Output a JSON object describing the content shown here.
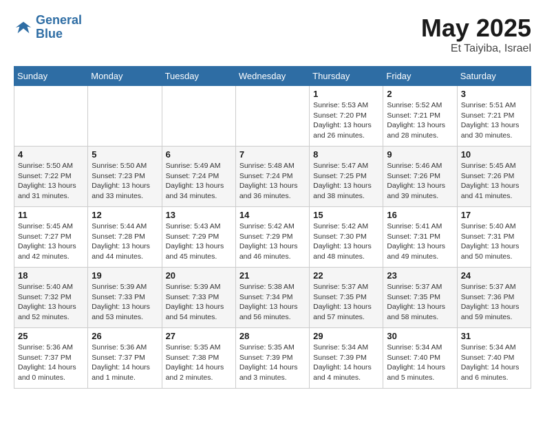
{
  "header": {
    "logo_line1": "General",
    "logo_line2": "Blue",
    "month_title": "May 2025",
    "location": "Et Taiyiba, Israel"
  },
  "days_of_week": [
    "Sunday",
    "Monday",
    "Tuesday",
    "Wednesday",
    "Thursday",
    "Friday",
    "Saturday"
  ],
  "weeks": [
    [
      {
        "day": "",
        "info": ""
      },
      {
        "day": "",
        "info": ""
      },
      {
        "day": "",
        "info": ""
      },
      {
        "day": "",
        "info": ""
      },
      {
        "day": "1",
        "info": "Sunrise: 5:53 AM\nSunset: 7:20 PM\nDaylight: 13 hours\nand 26 minutes."
      },
      {
        "day": "2",
        "info": "Sunrise: 5:52 AM\nSunset: 7:21 PM\nDaylight: 13 hours\nand 28 minutes."
      },
      {
        "day": "3",
        "info": "Sunrise: 5:51 AM\nSunset: 7:21 PM\nDaylight: 13 hours\nand 30 minutes."
      }
    ],
    [
      {
        "day": "4",
        "info": "Sunrise: 5:50 AM\nSunset: 7:22 PM\nDaylight: 13 hours\nand 31 minutes."
      },
      {
        "day": "5",
        "info": "Sunrise: 5:50 AM\nSunset: 7:23 PM\nDaylight: 13 hours\nand 33 minutes."
      },
      {
        "day": "6",
        "info": "Sunrise: 5:49 AM\nSunset: 7:24 PM\nDaylight: 13 hours\nand 34 minutes."
      },
      {
        "day": "7",
        "info": "Sunrise: 5:48 AM\nSunset: 7:24 PM\nDaylight: 13 hours\nand 36 minutes."
      },
      {
        "day": "8",
        "info": "Sunrise: 5:47 AM\nSunset: 7:25 PM\nDaylight: 13 hours\nand 38 minutes."
      },
      {
        "day": "9",
        "info": "Sunrise: 5:46 AM\nSunset: 7:26 PM\nDaylight: 13 hours\nand 39 minutes."
      },
      {
        "day": "10",
        "info": "Sunrise: 5:45 AM\nSunset: 7:26 PM\nDaylight: 13 hours\nand 41 minutes."
      }
    ],
    [
      {
        "day": "11",
        "info": "Sunrise: 5:45 AM\nSunset: 7:27 PM\nDaylight: 13 hours\nand 42 minutes."
      },
      {
        "day": "12",
        "info": "Sunrise: 5:44 AM\nSunset: 7:28 PM\nDaylight: 13 hours\nand 44 minutes."
      },
      {
        "day": "13",
        "info": "Sunrise: 5:43 AM\nSunset: 7:29 PM\nDaylight: 13 hours\nand 45 minutes."
      },
      {
        "day": "14",
        "info": "Sunrise: 5:42 AM\nSunset: 7:29 PM\nDaylight: 13 hours\nand 46 minutes."
      },
      {
        "day": "15",
        "info": "Sunrise: 5:42 AM\nSunset: 7:30 PM\nDaylight: 13 hours\nand 48 minutes."
      },
      {
        "day": "16",
        "info": "Sunrise: 5:41 AM\nSunset: 7:31 PM\nDaylight: 13 hours\nand 49 minutes."
      },
      {
        "day": "17",
        "info": "Sunrise: 5:40 AM\nSunset: 7:31 PM\nDaylight: 13 hours\nand 50 minutes."
      }
    ],
    [
      {
        "day": "18",
        "info": "Sunrise: 5:40 AM\nSunset: 7:32 PM\nDaylight: 13 hours\nand 52 minutes."
      },
      {
        "day": "19",
        "info": "Sunrise: 5:39 AM\nSunset: 7:33 PM\nDaylight: 13 hours\nand 53 minutes."
      },
      {
        "day": "20",
        "info": "Sunrise: 5:39 AM\nSunset: 7:33 PM\nDaylight: 13 hours\nand 54 minutes."
      },
      {
        "day": "21",
        "info": "Sunrise: 5:38 AM\nSunset: 7:34 PM\nDaylight: 13 hours\nand 56 minutes."
      },
      {
        "day": "22",
        "info": "Sunrise: 5:37 AM\nSunset: 7:35 PM\nDaylight: 13 hours\nand 57 minutes."
      },
      {
        "day": "23",
        "info": "Sunrise: 5:37 AM\nSunset: 7:35 PM\nDaylight: 13 hours\nand 58 minutes."
      },
      {
        "day": "24",
        "info": "Sunrise: 5:37 AM\nSunset: 7:36 PM\nDaylight: 13 hours\nand 59 minutes."
      }
    ],
    [
      {
        "day": "25",
        "info": "Sunrise: 5:36 AM\nSunset: 7:37 PM\nDaylight: 14 hours\nand 0 minutes."
      },
      {
        "day": "26",
        "info": "Sunrise: 5:36 AM\nSunset: 7:37 PM\nDaylight: 14 hours\nand 1 minute."
      },
      {
        "day": "27",
        "info": "Sunrise: 5:35 AM\nSunset: 7:38 PM\nDaylight: 14 hours\nand 2 minutes."
      },
      {
        "day": "28",
        "info": "Sunrise: 5:35 AM\nSunset: 7:39 PM\nDaylight: 14 hours\nand 3 minutes."
      },
      {
        "day": "29",
        "info": "Sunrise: 5:34 AM\nSunset: 7:39 PM\nDaylight: 14 hours\nand 4 minutes."
      },
      {
        "day": "30",
        "info": "Sunrise: 5:34 AM\nSunset: 7:40 PM\nDaylight: 14 hours\nand 5 minutes."
      },
      {
        "day": "31",
        "info": "Sunrise: 5:34 AM\nSunset: 7:40 PM\nDaylight: 14 hours\nand 6 minutes."
      }
    ]
  ]
}
